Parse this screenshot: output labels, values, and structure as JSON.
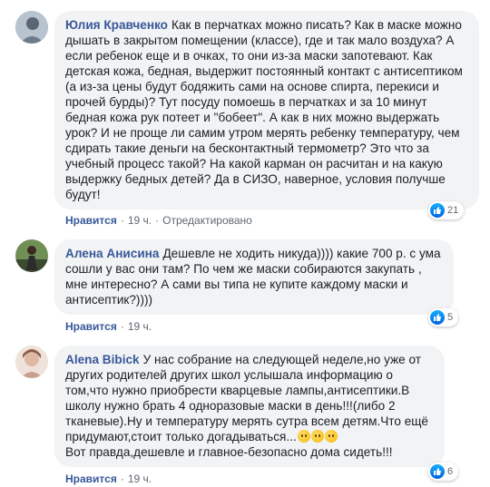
{
  "comments": [
    {
      "author": "Юлия Кравченко",
      "text": "Как в перчатках можно писать? Как в маске можно дышать в закрытом помещении (классе), где и так мало воздуха? А если ребенок еще и в очках, то они из-за маски запотевают. Как детская кожа, бедная, выдержит постоянный контакт с антисептиком (а из-за цены будут бодяжить сами на основе спирта, перекиси и прочей бурды)? Тут посуду помоешь в перчатках и за 10 минут бедная кожа рук потеет и \"бобеет\". А как в них можно выдержать урок? И не проще ли самим утром мерять ребенку температуру, чем сдирать такие деньги на бесконтактный термометр? Это что за учебный процесс такой? На какой карман он расчитан и на какую выдержку бедных детей? Да в СИЗО, наверное, условия получше будут!",
      "like_label": "Нравится",
      "time": "19 ч.",
      "edited": "Отредактировано",
      "reactions": "21",
      "avatar_colors": [
        "#7f95a8",
        "#c9d2da"
      ]
    },
    {
      "author": "Алена Анисина",
      "text": "Дешевле не ходить никуда)))) какие 700 р. с ума сошли у вас они там? По чем же маски собираются закупать , мне интересно? А сами вы типа не купите каждому маски и антисептик?))))",
      "like_label": "Нравится",
      "time": "19 ч.",
      "reactions": "5",
      "avatar_colors": [
        "#2e3b2a",
        "#7e9b5c"
      ]
    },
    {
      "author": "Alena Bibick",
      "text": "У нас собрание на следующей неделе,но уже от других родителей других школ услышала информацию о том,что нужно приобрести кварцевые лампы,антисептики.В школу нужно брать 4 одноразовые маски в день!!!(либо 2 тканевые).Ну и температуру мерять сутра всем детям.Что ещё придумают,стоит только догадываться...",
      "text2": "Вот правда,дешевле и главное-безопасно дома сидеть!!!",
      "like_label": "Нравится",
      "time": "19 ч.",
      "reactions": "6",
      "avatar_colors": [
        "#e6d7cf",
        "#b58b78"
      ]
    }
  ],
  "ui": {
    "accent": "#385898",
    "like_blue": "#1877f2"
  }
}
